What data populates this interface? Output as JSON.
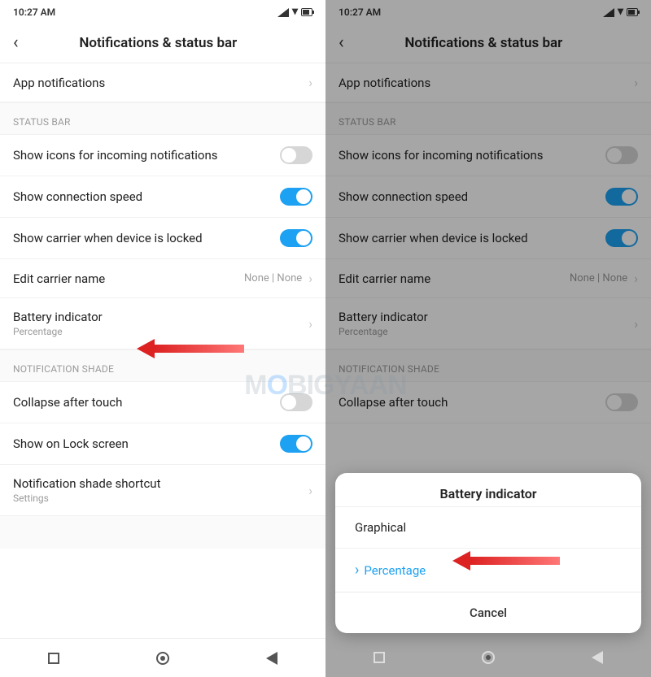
{
  "status": {
    "time": "10:27 AM",
    "battery_pct": "63"
  },
  "header": {
    "title": "Notifications & status bar"
  },
  "rows": {
    "app_notifications": "App notifications",
    "section_status": "STATUS BAR",
    "show_icons": "Show icons for incoming notifications",
    "conn_speed": "Show connection speed",
    "carrier_locked": "Show carrier when device is locked",
    "edit_carrier": "Edit carrier name",
    "edit_carrier_value": "None | None",
    "battery_indicator": "Battery indicator",
    "battery_indicator_sub": "Percentage",
    "section_shade": "NOTIFICATION SHADE",
    "collapse": "Collapse after touch",
    "lock_screen": "Show on Lock screen",
    "shade_shortcut": "Notification shade shortcut",
    "shade_shortcut_sub": "Settings"
  },
  "toggles": {
    "show_icons": false,
    "conn_speed": true,
    "carrier_locked": true,
    "collapse": false,
    "lock_screen": true
  },
  "sheet": {
    "title": "Battery indicator",
    "opt_graphical": "Graphical",
    "opt_percentage": "Percentage",
    "cancel": "Cancel"
  },
  "watermark": {
    "pre": "M",
    "o": "O",
    "post": "BIGYAAN"
  }
}
